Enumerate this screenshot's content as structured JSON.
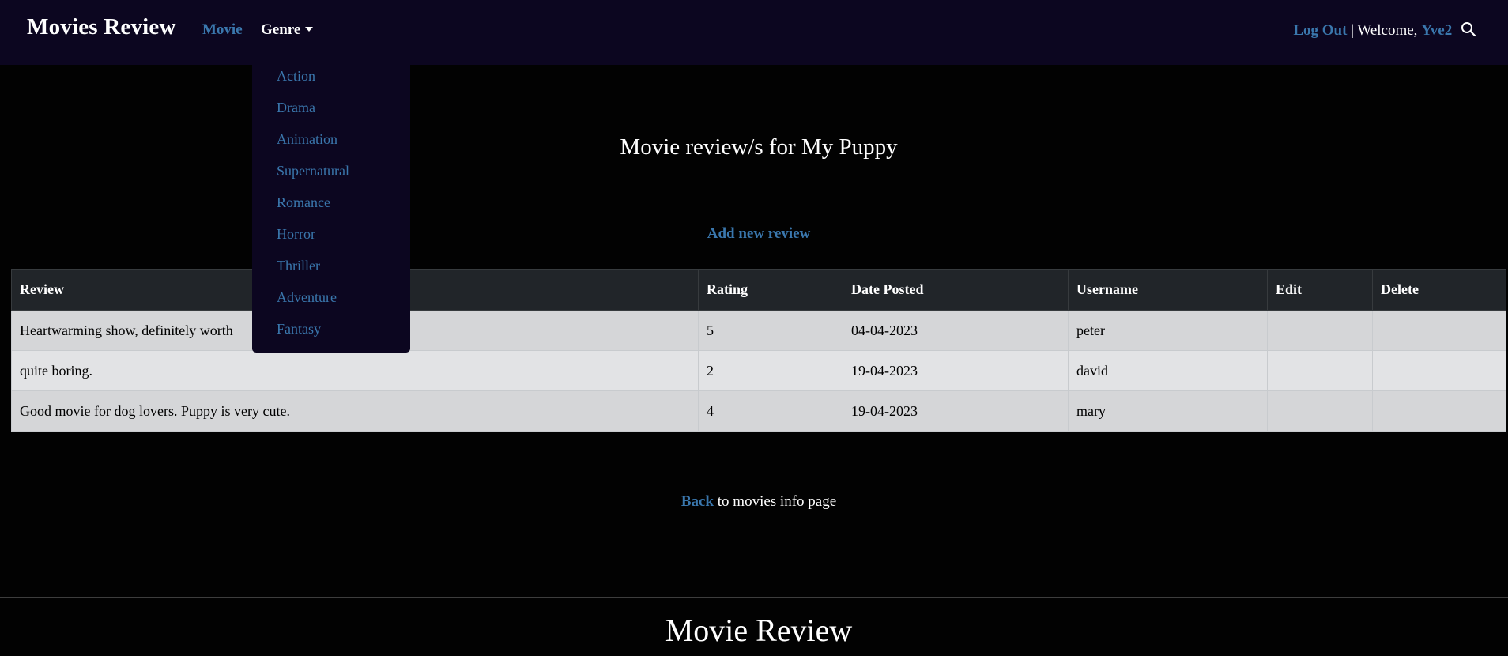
{
  "navbar": {
    "brand": "Movies Review",
    "movie_link": "Movie",
    "genre_toggle": "Genre",
    "logout": "Log Out",
    "separator": " | Welcome, ",
    "username": "Yve2",
    "search_icon": "search-icon"
  },
  "genre_menu": {
    "items": [
      "Action",
      "Drama",
      "Animation",
      "Supernatural",
      "Romance",
      "Horror",
      "Thriller",
      "Adventure",
      "Fantasy"
    ]
  },
  "main": {
    "title": "Movie review/s for My Puppy",
    "add_review": "Add new review"
  },
  "table": {
    "headers": [
      "Review",
      "Rating",
      "Date Posted",
      "Username",
      "Edit",
      "Delete"
    ],
    "rows": [
      {
        "review": "Heartwarming show, definitely worth",
        "rating": "5",
        "date": "04-04-2023",
        "username": "peter",
        "edit": "",
        "delete": ""
      },
      {
        "review": "quite boring.",
        "rating": "2",
        "date": "19-04-2023",
        "username": "david",
        "edit": "",
        "delete": ""
      },
      {
        "review": "Good movie for dog lovers. Puppy is very cute.",
        "rating": "4",
        "date": "19-04-2023",
        "username": "mary",
        "edit": "",
        "delete": ""
      }
    ]
  },
  "back": {
    "link": "Back",
    "text": " to movies info page"
  },
  "footer": {
    "title": "Movie Review"
  },
  "colors": {
    "navbar_bg": "#0c0620",
    "link": "#3a77ad",
    "page_bg": "#020202",
    "table_header": "#212529"
  }
}
